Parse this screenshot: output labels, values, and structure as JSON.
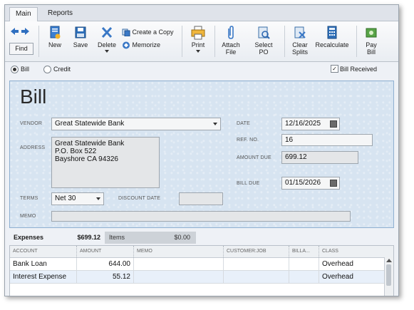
{
  "tabs": [
    {
      "label": "Main"
    },
    {
      "label": "Reports"
    }
  ],
  "toolbar": {
    "find": "Find",
    "new": "New",
    "save": "Save",
    "delete": "Delete",
    "create_copy": "Create a Copy",
    "memorize": "Memorize",
    "print": "Print",
    "attach_file": [
      "Attach",
      "File"
    ],
    "select_po": [
      "Select",
      "PO"
    ],
    "clear_splits": [
      "Clear",
      "Splits"
    ],
    "recalculate": "Recalculate",
    "pay_bill": [
      "Pay",
      "Bill"
    ]
  },
  "mode": {
    "bill": "Bill",
    "credit": "Credit",
    "selected": "bill",
    "bill_received_label": "Bill Received",
    "bill_received": true
  },
  "form": {
    "title": "Bill",
    "vendor_label": "VENDOR",
    "vendor": "Great Statewide Bank",
    "address_label": "ADDRESS",
    "address": "Great Statewide Bank\nP.O. Box 522\nBayshore CA 94326",
    "terms_label": "TERMS",
    "terms": "Net 30",
    "discount_date_label": "DISCOUNT DATE",
    "discount_date": "",
    "memo_label": "MEMO",
    "memo": "",
    "date_label": "DATE",
    "date": "12/16/2025",
    "ref_no_label": "REF. NO.",
    "ref_no": "16",
    "amount_due_label": "AMOUNT DUE",
    "amount_due": "699.12",
    "bill_due_label": "BILL DUE",
    "bill_due": "01/15/2026"
  },
  "detail_tabs": {
    "expenses_label": "Expenses",
    "expenses_total": "$699.12",
    "items_label": "Items",
    "items_total": "$0.00"
  },
  "grid": {
    "columns": [
      "ACCOUNT",
      "AMOUNT",
      "MEMO",
      "CUSTOMER:JOB",
      "BILLA...",
      "CLASS"
    ],
    "rows": [
      {
        "account": "Bank Loan",
        "amount": "644.00",
        "memo": "",
        "customer_job": "",
        "billable": "",
        "class": "Overhead"
      },
      {
        "account": "Interest Expense",
        "amount": "55.12",
        "memo": "",
        "customer_job": "",
        "billable": "",
        "class": "Overhead"
      }
    ]
  },
  "colors": {
    "accent": "#2a6ebb",
    "panel": "#d7e4f1"
  }
}
